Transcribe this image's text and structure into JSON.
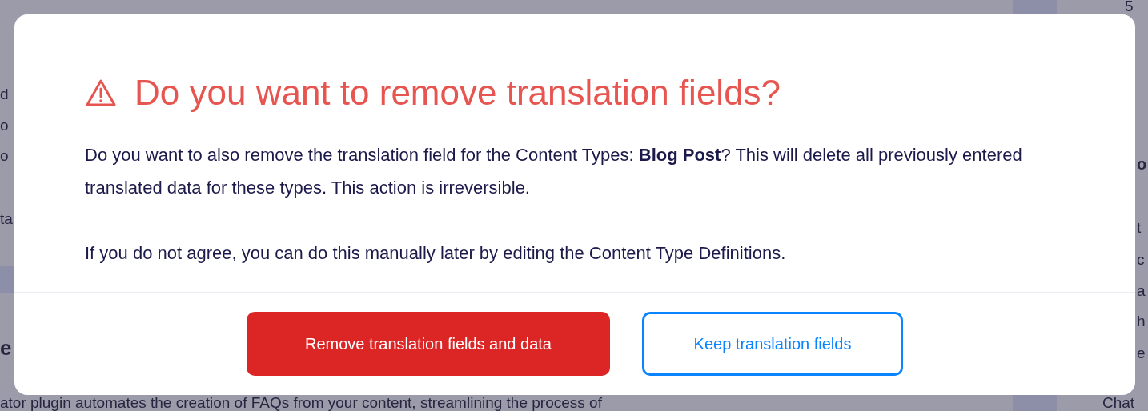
{
  "background": {
    "left_fragments": [
      {
        "text": "d",
        "kind": "line"
      },
      {
        "text": "o",
        "kind": "line"
      },
      {
        "text": "o",
        "kind": "line"
      },
      {
        "text": "ta",
        "kind": "line"
      },
      {
        "text": "e",
        "kind": "heading"
      }
    ],
    "right_fragments": [
      {
        "text": "5",
        "kind": "counter"
      },
      {
        "text": "o",
        "kind": "heading"
      },
      {
        "text": "t",
        "kind": "line"
      },
      {
        "text": "c",
        "kind": "line"
      },
      {
        "text": "a",
        "kind": "line"
      },
      {
        "text": "h",
        "kind": "line"
      },
      {
        "text": "e",
        "kind": "line"
      },
      {
        "text": "Chat",
        "kind": "line"
      }
    ],
    "bottom_line": "ator plugin automates the creation of FAQs from your content, streamlining the process of"
  },
  "modal": {
    "title": "Do you want to remove translation fields?",
    "paragraphs": [
      "Do you want to also remove the translation field for the Content Types: **Blog Post**? This will delete all previously entered translated data for these types. This action is irreversible.",
      "If you do not agree, you can do this manually later by editing the Content Type Definitions."
    ],
    "buttons": [
      {
        "label": "Remove translation fields and data",
        "kind": "danger"
      },
      {
        "label": "Keep translation fields",
        "kind": "outline"
      }
    ]
  }
}
